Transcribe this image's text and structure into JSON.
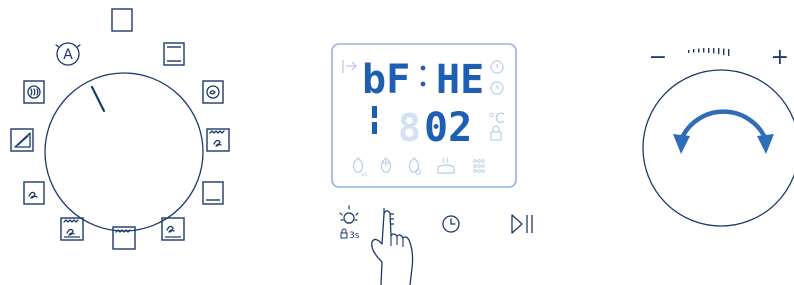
{
  "colors": {
    "ink": "#1b3a6b",
    "segment_on": "#1e5fb4",
    "segment_off": "#d3e1f2",
    "panel_border": "#8fb2e0",
    "arrow": "#2f6db8"
  },
  "mode_dial": {
    "auto_letter": "A",
    "modes": [
      "off-mode",
      "bottom-top-heat-mode",
      "hot-air-fan-mode",
      "grill-fan-mode",
      "top-heat-mode",
      "fan-bottom-heat-mode",
      "grill-mode",
      "fan-grill-bottom-mode",
      "fan-only-mode",
      "pizza-mode",
      "defrost-mode",
      "auto-programs-mode"
    ]
  },
  "display": {
    "top_left": "bF",
    "top_right": "HE",
    "bottom_digits": "02",
    "unit": "°C"
  },
  "buttons": {
    "light_sub": "3s",
    "light_icon": "lamp-icon",
    "menu_icon": "menu-touch-icon",
    "clock_icon": "clock-icon",
    "start_pause_icon": "start-pause-icon"
  },
  "temp_knob": {
    "minus": "−",
    "plus": "+"
  }
}
